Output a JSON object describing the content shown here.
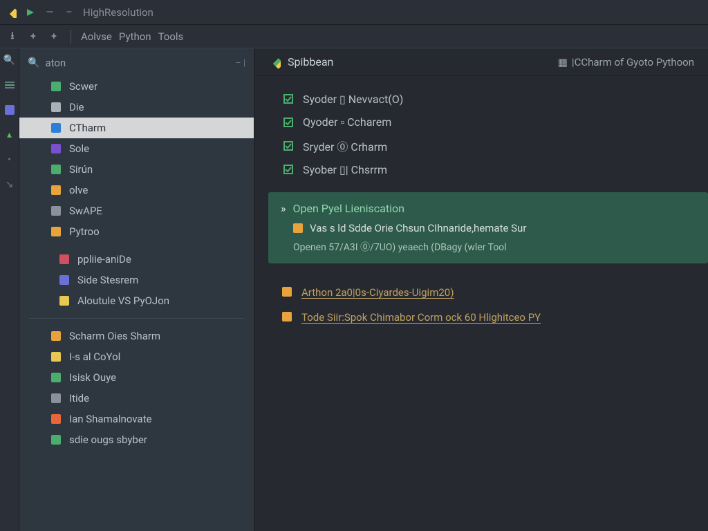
{
  "colors": {
    "accent_yellow": "#f2c94c",
    "accent_green": "#4cae6e",
    "panel_green": "#2d5a4a",
    "panel_text": "#8fd9b0",
    "link": "#c0a060"
  },
  "titlebar": {
    "title": "HighResolution"
  },
  "toolbar": {
    "label1": "Aolvse",
    "label2": "Python",
    "label3": "Tools"
  },
  "sidebar": {
    "search": {
      "label": "aton"
    },
    "group1": [
      {
        "icon": "scwer-icon",
        "label": "Scwer",
        "color": "#4cae6e"
      },
      {
        "icon": "die-icon",
        "label": "Die",
        "color": "#a8b0b8"
      },
      {
        "icon": "charm-icon",
        "label": "CTharm",
        "color": "#2b7fd9",
        "selected": true
      },
      {
        "icon": "sole-icon",
        "label": "Sole",
        "color": "#7a4fd0"
      },
      {
        "icon": "sirun-icon",
        "label": "Sirún",
        "color": "#4cae6e"
      },
      {
        "icon": "olve-icon",
        "label": "olve",
        "color": "#e8a33c"
      },
      {
        "icon": "swape-icon",
        "label": "SwAPE",
        "color": "#8a919a"
      },
      {
        "icon": "python-icon",
        "label": "Pytroo",
        "color": "#e8a33c"
      }
    ],
    "group2": [
      {
        "icon": "pplite-icon",
        "label": "ppliie-aniDe",
        "color": "#d05060"
      },
      {
        "icon": "side-icon",
        "label": "Side Stesrem",
        "color": "#6a70d8"
      },
      {
        "icon": "module-icon",
        "label": "Aloutule VS PyOJon",
        "color": "#e8c850"
      }
    ],
    "group3": [
      {
        "icon": "scharm-icon",
        "label": "Scharm Oies Sharm",
        "color": "#e8a33c"
      },
      {
        "icon": "control-icon",
        "label": "I-s al CoYol",
        "color": "#e8c850"
      },
      {
        "icon": "ouye-icon",
        "label": "Isisk Ouye",
        "color": "#4cae6e"
      },
      {
        "icon": "tide-icon",
        "label": "Itide",
        "color": "#8a919a"
      },
      {
        "icon": "shama-icon",
        "label": "Ian Shamalnovate",
        "color": "#e8663c"
      },
      {
        "icon": "sbyber-icon",
        "label": "sdie ougs sbyber",
        "color": "#4cae6e"
      }
    ]
  },
  "content": {
    "header": {
      "title": "Spibbean",
      "crumb": "|CCharm of Gyoto Pythoon"
    },
    "items": [
      {
        "icon": "spyder-icon",
        "label": "Syoder ▯ Nevvact(O)",
        "color": "#4cae6e"
      },
      {
        "icon": "qyoder-icon",
        "label": "Qyoder ▫ Ccharem",
        "color": "#4cae6e"
      },
      {
        "icon": "sryder-icon",
        "label": "Sryder ⓪ Crharm",
        "color": "#4cae6e"
      },
      {
        "icon": "syober-icon",
        "label": "Syober ▯| Chsrrm",
        "color": "#4cae6e"
      }
    ],
    "panel": {
      "title": "Open Pyel Lieniscation",
      "row": "Vas s ld Sdde Orie Chsun CIhnaride,hemate Sur",
      "sub": "Openen 57/A3I ⓪/7UO) yeaech (DBagy (wler Tool"
    },
    "links": [
      {
        "icon": "arthor-icon",
        "label": "Arthon 2a0|0s-Ciyardes-Uigim20)",
        "color": "#e8a33c"
      },
      {
        "icon": "tode-icon",
        "label": "Tode Siir:Spok Chimabor Corm ock 60 Hlighitceo PY",
        "color": "#e8a33c"
      }
    ]
  }
}
